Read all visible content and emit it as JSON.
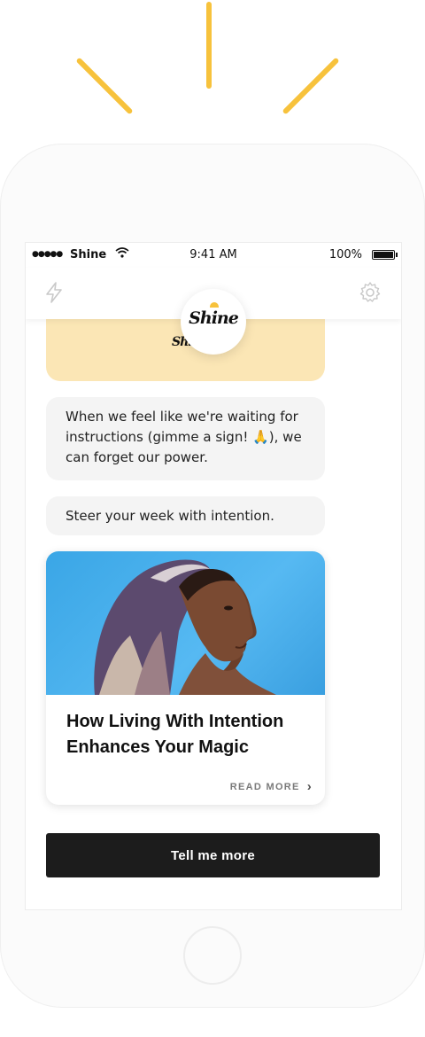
{
  "status_bar": {
    "signal_dots": "●●●●●",
    "carrier": "Shine",
    "time": "9:41 AM",
    "battery": "100%"
  },
  "nav": {
    "left_icon": "lightning-bolt-icon",
    "right_icon": "gear-icon",
    "logo_text": "Shine"
  },
  "chat": {
    "yellow_card_logo": "Shine",
    "messages": [
      "When we feel like we're waiting for instructions (gimme a sign! 🙏), we can forget our power.",
      "Steer your week with intention."
    ]
  },
  "article": {
    "title": "How Living With Intention Enhances Your Magic",
    "read_more": "READ MORE"
  },
  "cta": {
    "label": "Tell me more"
  },
  "colors": {
    "accent_yellow": "#f7c23c",
    "card_yellow": "#fbe6b5",
    "bubble_bg": "#f4f4f4",
    "cta_bg": "#1c1c1c",
    "image_bg": "#45aeea"
  }
}
